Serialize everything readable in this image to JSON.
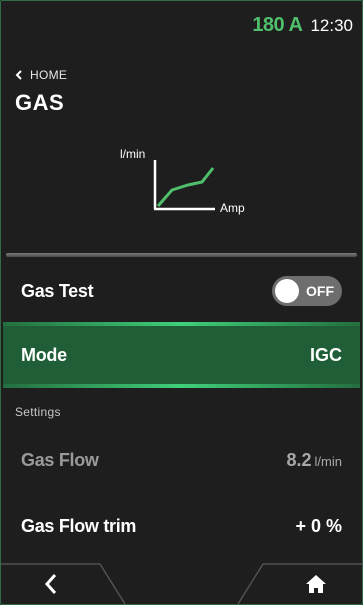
{
  "status": {
    "current": "180 A",
    "time": "12:30"
  },
  "breadcrumb": {
    "label": "HOME"
  },
  "page": {
    "title": "GAS"
  },
  "graph": {
    "y_label": "l/min",
    "x_label": "Amp"
  },
  "gas_test": {
    "label": "Gas Test",
    "state": "OFF"
  },
  "mode": {
    "label": "Mode",
    "value": "IGC"
  },
  "settings": {
    "section_label": "Settings"
  },
  "gas_flow": {
    "label": "Gas Flow",
    "value": "8.2",
    "unit": "l/min"
  },
  "gas_flow_trim": {
    "label": "Gas Flow trim",
    "value": "+ 0 %"
  },
  "colors": {
    "accent": "#4fbf6c",
    "mode_bg": "#1f5e37",
    "toggle_off": "#6e6e6e"
  },
  "icons": {
    "back": "chevron-left-icon",
    "home": "home-icon"
  }
}
